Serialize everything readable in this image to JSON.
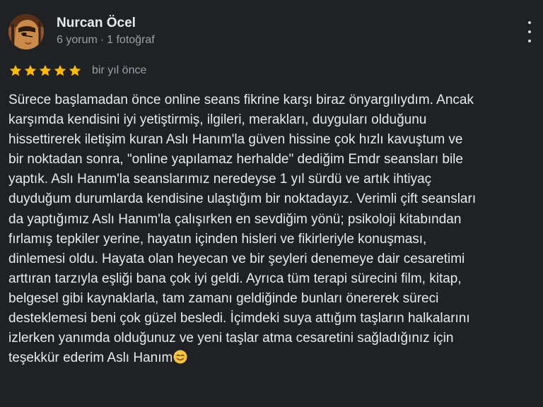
{
  "reviewer": {
    "name": "Nurcan Öcel",
    "reviews_count": "6 yorum",
    "separator": "·",
    "photos_count": "1 fotoğraf"
  },
  "review": {
    "rating": 5,
    "max_rating": 5,
    "time_ago": "bir yıl önce",
    "lines": [
      "Sürece başlamadan önce online seans fikrine karşı biraz önyargılıydım. Ancak",
      "karşımda kendisini iyi yetiştirmiş, ilgileri, merakları, duyguları olduğunu",
      "hissettirerek iletişim kuran Aslı Hanım'la güven hissine çok hızlı kavuştum ve",
      "bir noktadan sonra, \"online yapılamaz herhalde\" dediğim Emdr seansları bile",
      "yaptık. Aslı Hanım'la seanslarımız neredeyse 1 yıl sürdü ve artık ihtiyaç",
      "duyduğum durumlarda kendisine ulaştığım bir noktadayız. Verimli çift seansları",
      "da yaptığımız Aslı Hanım'la çalışırken en sevdiğim yönü; psikoloji kitabından",
      "fırlamış tepkiler yerine, hayatın içinden hisleri ve fikirleriyle konuşması,",
      "dinlemesi oldu. Hayata olan heyecan ve bir şeyleri denemeye dair cesaretimi",
      "arttıran tarzıyla eşliği bana çok iyi geldi. Ayrıca tüm terapi sürecini film, kitap,",
      "belgesel gibi kaynaklarla, tam zamanı geldiğinde bunları önererek süreci",
      "desteklemesi beni çok güzel besledi. İçimdeki suya attığım taşların halkalarını",
      "izlerken yanımda olduğunuz ve yeni taşlar atma cesaretini sağladığınız için",
      "teşekkür ederim Aslı Hanım"
    ],
    "end_emoji": "smiling-face-emoji"
  },
  "colors": {
    "background": "#202124",
    "text": "#e8eaed",
    "secondary_text": "#9aa0a6",
    "star": "#fbbc04"
  },
  "icons": {
    "menu": "more-vert-icon",
    "rating": "star-icon"
  }
}
